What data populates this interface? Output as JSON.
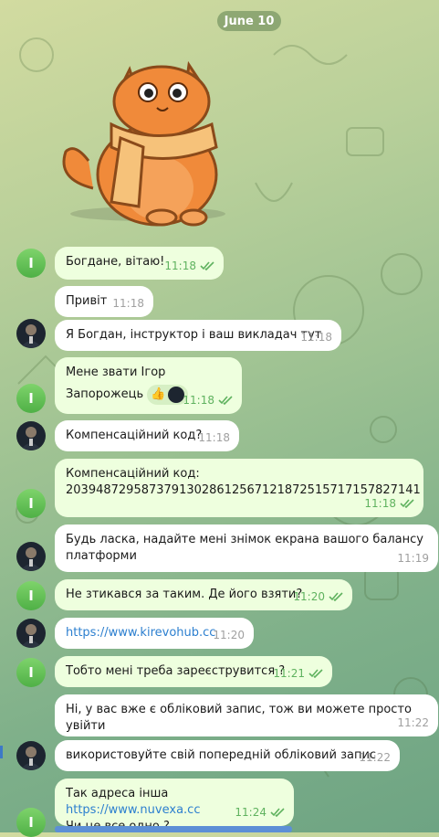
{
  "date_label": "June 10",
  "my_avatar_letter": "I",
  "messages": [
    {
      "text": "Богдане, вітаю!",
      "time": "11:18"
    },
    {
      "text": "Привіт",
      "time": "11:18"
    },
    {
      "text": "Я Богдан, інструктор і ваш викладач тут",
      "time": "11:18"
    },
    {
      "text": "Мене звати Ігор Запорожець",
      "time": "11:18",
      "reaction": "👍"
    },
    {
      "text": "Компенсаційний код?",
      "time": "11:18"
    },
    {
      "text": "Компенсаційний код:\n20394872958737913028612567121872515717157827141",
      "time": "11:18"
    },
    {
      "text": "Будь ласка, надайте мені знімок екрана вашого балансу\nплатформи",
      "time": "11:19"
    },
    {
      "text": "Не зтикався за таким.  Де його взяти?",
      "time": "11:20"
    },
    {
      "text": "https://www.kirevohub.cc",
      "time": "11:20"
    },
    {
      "text": "Тобто мені треба зареєструвится ?",
      "time": "11:21"
    },
    {
      "text": "Ні, у вас вже є обліковий запис, тож ви можете просто увійти",
      "time": "11:22"
    },
    {
      "text": "використовуйте свій попередній обліковий запис",
      "time": "11:22"
    },
    {
      "text_before": "Так адреса інша ",
      "link": "https://www.nuvexa.cc",
      "text_after": "Чи це все одно ?",
      "time": "11:24"
    }
  ],
  "colors": {
    "outgoing_bubble": "#eeffde",
    "incoming_bubble": "#ffffff",
    "link": "#2c7fcf",
    "read_check": "#5fb25f",
    "avatar_green": "#4fb046"
  }
}
